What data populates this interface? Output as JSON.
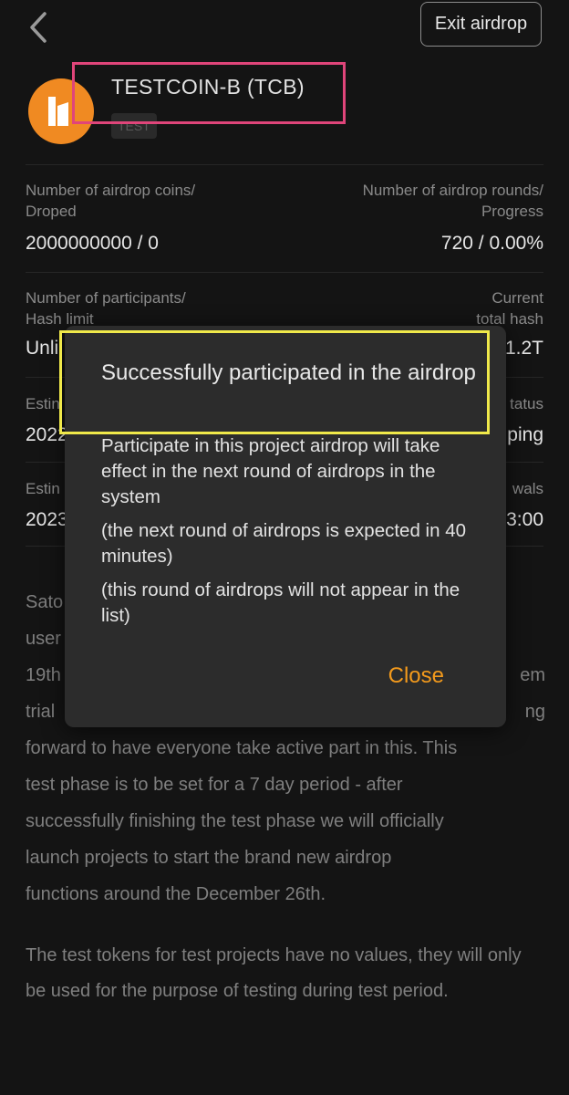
{
  "header": {
    "exit_label": "Exit airdrop"
  },
  "coin": {
    "name": "TESTCOIN-B (TCB)",
    "tag": "TEST",
    "logo_color": "#f08a22"
  },
  "stats": {
    "coins_label_1": "Number of airdrop coins/",
    "coins_label_2": "Droped",
    "coins_value": "2000000000 / 0",
    "rounds_label_1": "Number of airdrop rounds/",
    "rounds_label_2": "Progress",
    "rounds_value": "720 / 0.00%",
    "participants_label_1": "Number of participants/",
    "participants_label_2": "Hash limit",
    "participants_value": "Unli",
    "hash_label_1": "Current",
    "hash_label_2": "total hash",
    "hash_value": "1.2T",
    "row3_left_label": "Estin",
    "row3_left_value": "2022",
    "row3_right_label": "tatus",
    "row3_right_value": "ping",
    "row4_left_label": "Estin",
    "row4_left_value": "2023",
    "row4_right_label": "wals",
    "row4_right_value": "3:00"
  },
  "description": {
    "line1": "Sato",
    "line2": "user",
    "line3_left": "19th",
    "line3_right": "em",
    "line4_left": "trial",
    "line4_right": "ng",
    "line5": "forward to have everyone take active part in this. This",
    "line6": "test phase is to be set for a 7 day period - after",
    "line7": "successfully finishing the test phase we will officially",
    "line8": "launch projects to start the brand new airdrop",
    "line9": "functions around the December 26th.",
    "para2": "The test tokens for test projects have no values, they will only be used for the purpose of testing during test period."
  },
  "modal": {
    "title": "Successfully participated in the airdrop",
    "body_1": "Participate in this project airdrop will take effect in the next round of airdrops in the system",
    "body_2": "(the next round of airdrops is expected in 40 minutes)",
    "body_3": "(this round of airdrops will not appear in the list)",
    "close_label": "Close",
    "accent_color": "#f39a1c"
  },
  "annotations": {
    "pink": "#e0457a",
    "yellow": "#f0e94a"
  }
}
